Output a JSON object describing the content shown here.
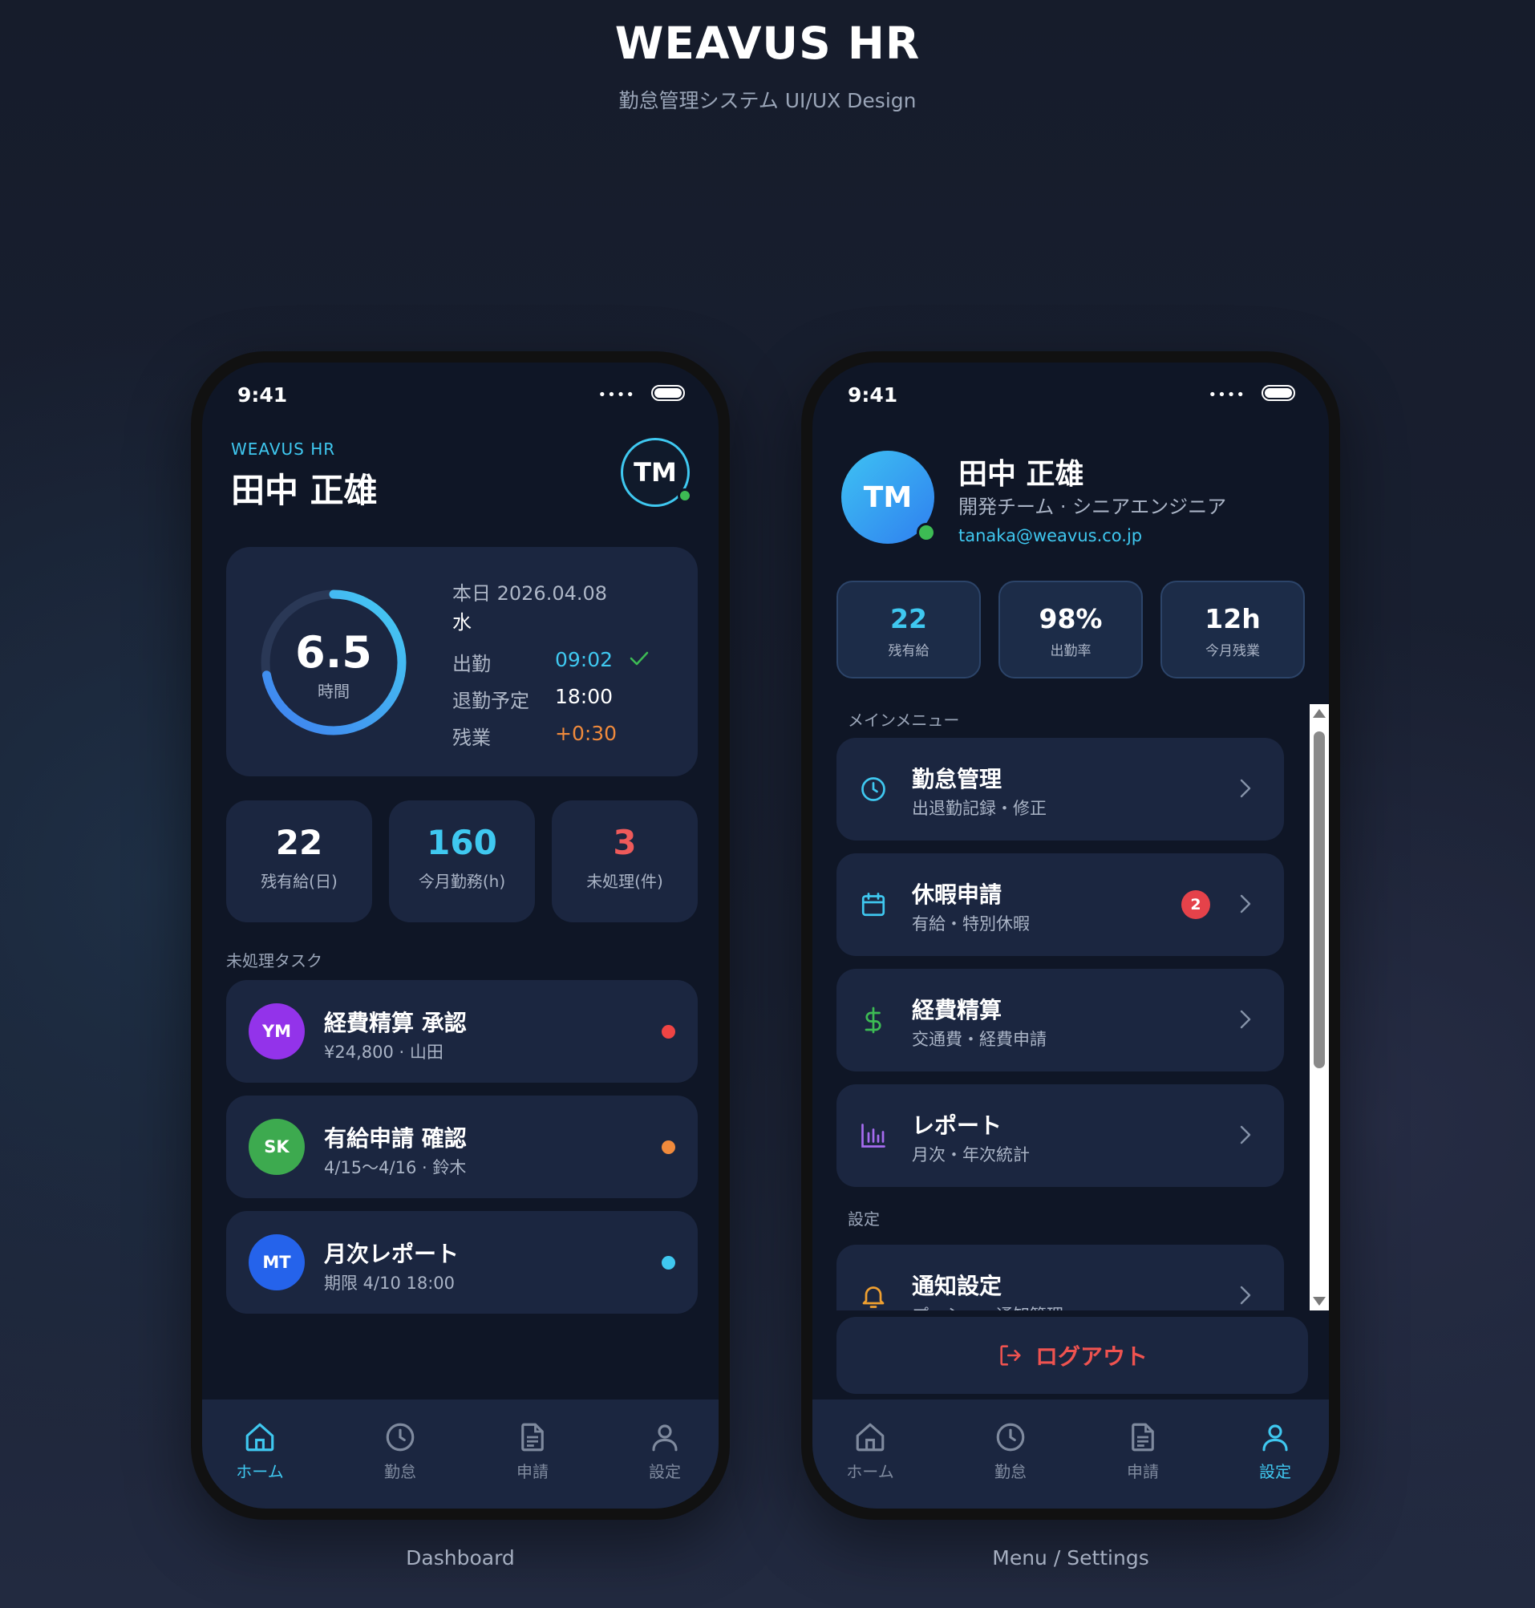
{
  "header": {
    "title": "WEAVUS HR",
    "subtitle": "勤怠管理システム UI/UX Design"
  },
  "status_bar": {
    "time": "9:41",
    "signal": "••••"
  },
  "colors": {
    "accent": "#3fc8f0",
    "card": "#1b2640",
    "screen_bg": "#0f1626",
    "orange": "#f08a3c",
    "red": "#e5424a",
    "green": "#3dbb54"
  },
  "dashboard": {
    "caption": "Dashboard",
    "brand": "WEAVUS HR",
    "user_name": "田中 正雄",
    "avatar_initials": "TM",
    "today": {
      "hours_value": "6.5",
      "hours_label": "時間",
      "progress_fraction": 0.72,
      "date_line": "本日 2026.04.08",
      "weekday": "水",
      "clock_in_label": "出勤",
      "clock_in_value": "09:02",
      "clock_out_label": "退勤予定",
      "clock_out_value": "18:00",
      "overtime_label": "残業",
      "overtime_value": "+0:30"
    },
    "stats": [
      {
        "value": "22",
        "label": "残有給(日)",
        "color": "#ffffff"
      },
      {
        "value": "160",
        "label": "今月勤務(h)",
        "color": "#3fc8f0"
      },
      {
        "value": "3",
        "label": "未処理(件)",
        "color": "#ee5a5a"
      }
    ],
    "tasks_label": "未処理タスク",
    "tasks": [
      {
        "initials": "YM",
        "avatar_color": "#9333ea",
        "title": "経費精算 承認",
        "sub": "¥24,800 · 山田",
        "dot_color": "#ef4444"
      },
      {
        "initials": "SK",
        "avatar_color": "#3daa4f",
        "title": "有給申請 確認",
        "sub": "4/15〜4/16 · 鈴木",
        "dot_color": "#f08a3c"
      },
      {
        "initials": "MT",
        "avatar_color": "#2563eb",
        "title": "月次レポート",
        "sub": "期限 4/10 18:00",
        "dot_color": "#3fc8f0"
      }
    ],
    "nav": [
      {
        "label": "ホーム",
        "icon": "home-icon",
        "active": true
      },
      {
        "label": "勤怠",
        "icon": "clock-icon",
        "active": false
      },
      {
        "label": "申請",
        "icon": "document-icon",
        "active": false
      },
      {
        "label": "設定",
        "icon": "user-icon",
        "active": false
      }
    ]
  },
  "settings": {
    "caption": "Menu / Settings",
    "avatar_initials": "TM",
    "user_name": "田中 正雄",
    "role": "開発チーム · シニアエンジニア",
    "email": "tanaka@weavus.co.jp",
    "stats": [
      {
        "value": "22",
        "label": "残有給",
        "color": "#3fc8f0"
      },
      {
        "value": "98%",
        "label": "出勤率",
        "color": "#ffffff"
      },
      {
        "value": "12h",
        "label": "今月残業",
        "color": "#ffffff"
      }
    ],
    "main_menu_label": "メインメニュー",
    "menu": [
      {
        "title": "勤怠管理",
        "sub": "出退勤記録・修正",
        "icon": "clock-icon",
        "icon_color": "#3fc8f0",
        "badge": ""
      },
      {
        "title": "休暇申請",
        "sub": "有給・特別休暇",
        "icon": "calendar-icon",
        "icon_color": "#3fc8f0",
        "badge": "2"
      },
      {
        "title": "経費精算",
        "sub": "交通費・経費申請",
        "icon": "dollar-icon",
        "icon_color": "#3dbb54",
        "badge": ""
      },
      {
        "title": "レポート",
        "sub": "月次・年次統計",
        "icon": "bar-chart-icon",
        "icon_color": "#a66cf0",
        "badge": ""
      }
    ],
    "settings_label": "設定",
    "settings_menu": [
      {
        "title": "通知設定",
        "sub": "プッシュ・通知管理",
        "icon": "bell-icon",
        "icon_color": "#f0a030"
      }
    ],
    "logout_label": "ログアウト",
    "nav": [
      {
        "label": "ホーム",
        "icon": "home-icon",
        "active": false
      },
      {
        "label": "勤怠",
        "icon": "clock-icon",
        "active": false
      },
      {
        "label": "申請",
        "icon": "document-icon",
        "active": false
      },
      {
        "label": "設定",
        "icon": "user-icon",
        "active": true
      }
    ]
  }
}
